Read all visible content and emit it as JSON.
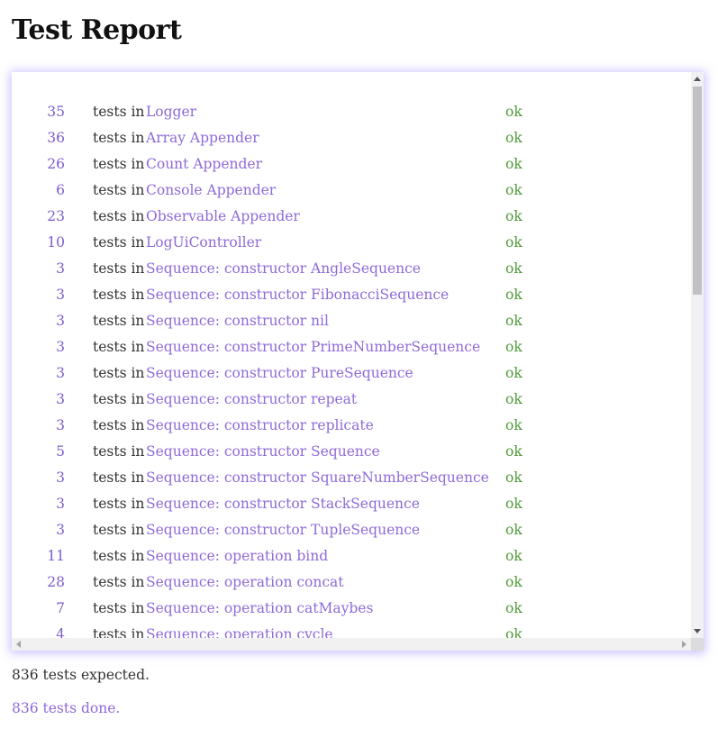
{
  "page": {
    "title": "Test Report"
  },
  "report": {
    "label": "tests in",
    "rows": [
      {
        "count": "35",
        "name": "Logger",
        "status": "ok"
      },
      {
        "count": "36",
        "name": "Array Appender",
        "status": "ok"
      },
      {
        "count": "26",
        "name": "Count Appender",
        "status": "ok"
      },
      {
        "count": "6",
        "name": "Console Appender",
        "status": "ok"
      },
      {
        "count": "23",
        "name": "Observable Appender",
        "status": "ok"
      },
      {
        "count": "10",
        "name": "LogUiController",
        "status": "ok"
      },
      {
        "count": "3",
        "name": "Sequence: constructor AngleSequence",
        "status": "ok"
      },
      {
        "count": "3",
        "name": "Sequence: constructor FibonacciSequence",
        "status": "ok"
      },
      {
        "count": "3",
        "name": "Sequence: constructor nil",
        "status": "ok"
      },
      {
        "count": "3",
        "name": "Sequence: constructor PrimeNumberSequence",
        "status": "ok"
      },
      {
        "count": "3",
        "name": "Sequence: constructor PureSequence",
        "status": "ok"
      },
      {
        "count": "3",
        "name": "Sequence: constructor repeat",
        "status": "ok"
      },
      {
        "count": "3",
        "name": "Sequence: constructor replicate",
        "status": "ok"
      },
      {
        "count": "5",
        "name": "Sequence: constructor Sequence",
        "status": "ok"
      },
      {
        "count": "3",
        "name": "Sequence: constructor SquareNumberSequence",
        "status": "ok"
      },
      {
        "count": "3",
        "name": "Sequence: constructor StackSequence",
        "status": "ok"
      },
      {
        "count": "3",
        "name": "Sequence: constructor TupleSequence",
        "status": "ok"
      },
      {
        "count": "11",
        "name": "Sequence: operation bind",
        "status": "ok"
      },
      {
        "count": "28",
        "name": "Sequence: operation concat",
        "status": "ok"
      },
      {
        "count": "7",
        "name": "Sequence: operation catMaybes",
        "status": "ok"
      },
      {
        "count": "4",
        "name": "Sequence: operation cycle",
        "status": "ok"
      }
    ]
  },
  "summary": {
    "expected": "836 tests expected.",
    "done": "836 tests done."
  },
  "colors": {
    "count": "#7c5ccf",
    "name": "#8e6ad8",
    "status_ok": "#4f9a37",
    "panel_glow": "#a08cff"
  }
}
